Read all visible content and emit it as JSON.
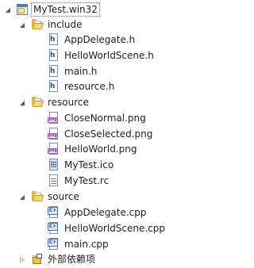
{
  "tree": {
    "project": {
      "label": "MyTest.win32",
      "expander": "◢"
    },
    "folders": [
      {
        "label": "include",
        "expander": "◢",
        "files": [
          {
            "label": "AppDelegate.h",
            "type": "h"
          },
          {
            "label": "HelloWorldScene.h",
            "type": "h"
          },
          {
            "label": "main.h",
            "type": "h"
          },
          {
            "label": "resource.h",
            "type": "h"
          }
        ]
      },
      {
        "label": "resource",
        "expander": "◢",
        "files": [
          {
            "label": "CloseNormal.png",
            "type": "png"
          },
          {
            "label": "CloseSelected.png",
            "type": "png"
          },
          {
            "label": "HelloWorld.png",
            "type": "png"
          },
          {
            "label": "MyTest.ico",
            "type": "ico"
          },
          {
            "label": "MyTest.rc",
            "type": "rc"
          }
        ]
      },
      {
        "label": "source",
        "expander": "◢",
        "files": [
          {
            "label": "AppDelegate.cpp",
            "type": "cpp"
          },
          {
            "label": "HelloWorldScene.cpp",
            "type": "cpp"
          },
          {
            "label": "main.cpp",
            "type": "cpp"
          }
        ]
      }
    ],
    "external": {
      "label": "外部依赖项",
      "expander": "▷"
    },
    "icon_glyphs": {
      "h": "h",
      "png": "png",
      "cpp": "C+"
    }
  },
  "colors": {
    "folder": "#e0b84a",
    "selection_outline": "#6b6b6b",
    "text": "#1e1e1e"
  }
}
